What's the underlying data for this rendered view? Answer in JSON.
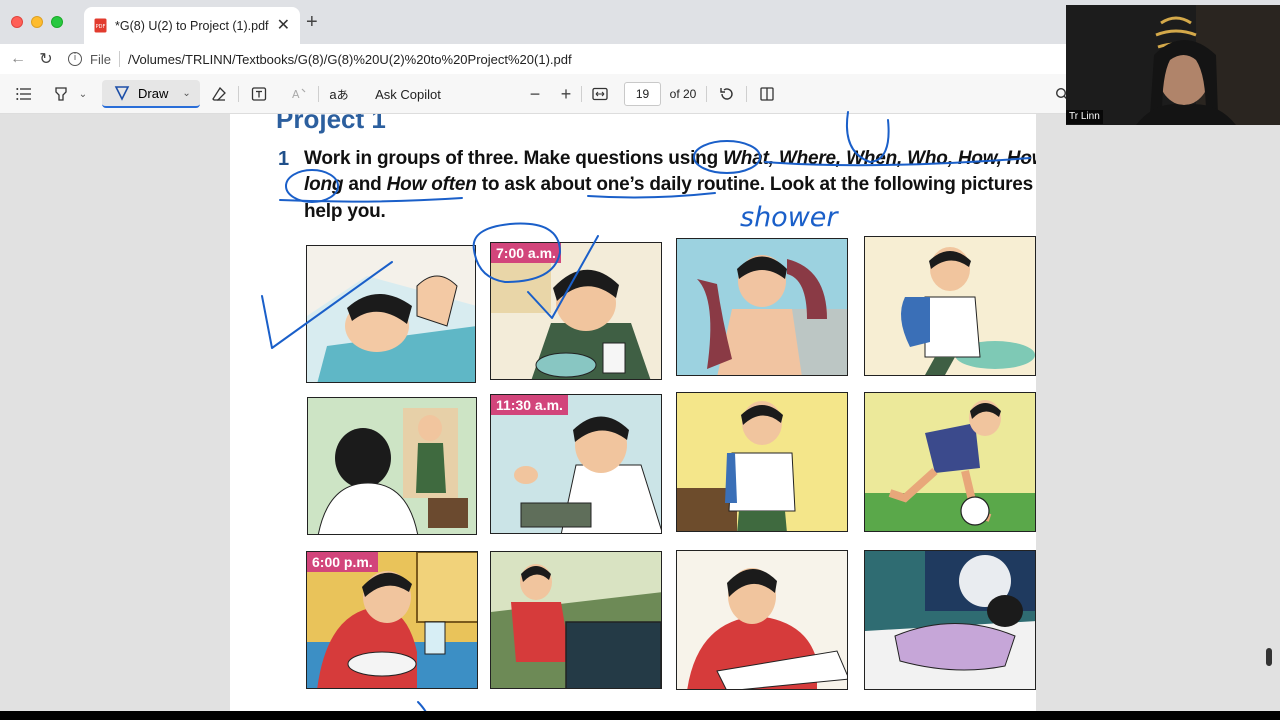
{
  "browser": {
    "tab_title": "*G(8) U(2) to Project (1).pdf",
    "new_tab": "+",
    "address_label": "File",
    "address_url": "/Volumes/TRLINN/Textbooks/G(8)/G(8)%20U(2)%20to%20Project%20(1).pdf"
  },
  "toolbar": {
    "draw_label": "Draw",
    "copilot_label": "Ask Copilot",
    "page_current": "19",
    "page_total": "of 20"
  },
  "document": {
    "section_title": "Project 1",
    "exercise_number": "1",
    "line1_a": "Work in groups of three.  Make questions using ",
    "line1_b": "What, Where, When, Who, How, How",
    "line2_a": "long",
    "line2_b": " and ",
    "line2_c": "How often",
    "line2_d": " to ask about one’s daily routine. Look at the following pictures to",
    "line3": "help you.",
    "panels": [
      {
        "time": ""
      },
      {
        "time": "7:00 a.m."
      },
      {
        "time": ""
      },
      {
        "time": ""
      },
      {
        "time": ""
      },
      {
        "time": "11:30 a.m."
      },
      {
        "time": ""
      },
      {
        "time": ""
      },
      {
        "time": "6:00 p.m."
      },
      {
        "time": ""
      },
      {
        "time": ""
      },
      {
        "time": ""
      }
    ]
  },
  "annotation": {
    "handwritten_word": "shower",
    "ink_color": "#1a5fc9"
  },
  "video": {
    "participant_name": "Tr Linn"
  }
}
